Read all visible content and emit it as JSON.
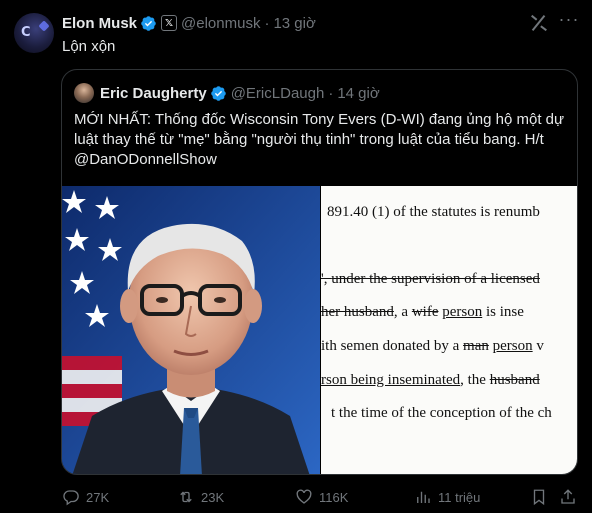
{
  "tweet": {
    "author_name": "Elon Musk",
    "handle": "@elonmusk",
    "separator": "·",
    "time": "13 giờ",
    "text": "Lộn xộn",
    "avatar_glyph": "C",
    "x_badge": "𝕏",
    "more_label": "···"
  },
  "quote": {
    "author_name": "Eric Daugherty",
    "handle": "@EricLDaugh",
    "separator": "·",
    "time": "14 giờ",
    "text": "MỚI NHẤT: Thống đốc Wisconsin Tony Evers (D-WI) đang ủng hộ một dự luật thay thế từ \"mẹ\" bằng \"người thụ tinh\" trong luật của tiểu bang. H/t @DanODonnellShow",
    "doc_lines": [
      {
        "parts": [
          {
            "t": "891.40 (1) of the statutes is renumb",
            "s": ""
          }
        ]
      },
      {
        "parts": [
          {
            "t": "', ",
            "s": "strike"
          },
          {
            "t": "under the supervision of a licensed",
            "s": "strike"
          }
        ]
      },
      {
        "parts": [
          {
            "t": "her husband",
            "s": "strike"
          },
          {
            "t": ", a ",
            "s": ""
          },
          {
            "t": "wife",
            "s": "strike"
          },
          {
            "t": " ",
            "s": ""
          },
          {
            "t": "person",
            "s": "uline"
          },
          {
            "t": " is inse",
            "s": ""
          }
        ]
      },
      {
        "parts": [
          {
            "t": "ith semen donated by a ",
            "s": ""
          },
          {
            "t": "man",
            "s": "strike"
          },
          {
            "t": " ",
            "s": ""
          },
          {
            "t": "person",
            "s": "uline"
          },
          {
            "t": " v",
            "s": ""
          }
        ]
      },
      {
        "parts": [
          {
            "t": "rson being inseminated",
            "s": "uline"
          },
          {
            "t": ", the ",
            "s": ""
          },
          {
            "t": "husband",
            "s": "strike"
          }
        ]
      },
      {
        "parts": [
          {
            "t": "t the time of the conception of the ch",
            "s": ""
          }
        ]
      }
    ]
  },
  "actions": {
    "replies": "27K",
    "reposts": "23K",
    "likes": "116K",
    "views": "11 triệu"
  },
  "colors": {
    "background": "#000000",
    "text": "#e7e9ea",
    "muted": "#71767b",
    "verified": "#1d9bf0",
    "border": "#2f3336"
  },
  "icons": [
    "verified-badge-icon",
    "x-badge-icon",
    "grok-icon",
    "more-icon",
    "reply-icon",
    "repost-icon",
    "like-icon",
    "views-icon",
    "bookmark-icon",
    "share-icon"
  ]
}
